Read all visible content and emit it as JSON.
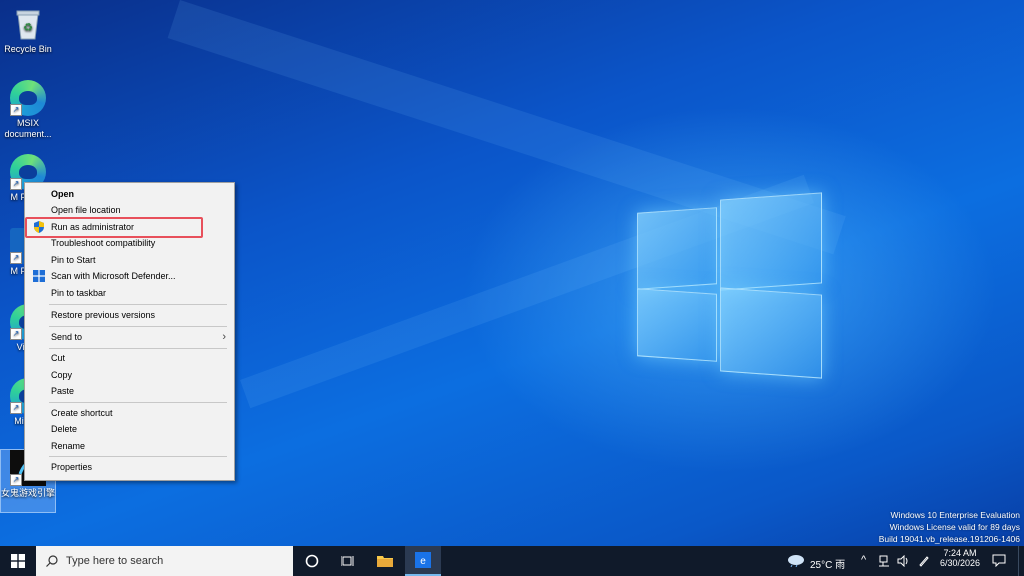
{
  "desktop": {
    "icons": [
      {
        "label": "Recycle Bin"
      },
      {
        "label": "MSIX document..."
      },
      {
        "label": "M Packa"
      },
      {
        "label": "M Packa"
      },
      {
        "label": "Vi Ma"
      },
      {
        "label": "Mic Ed"
      },
      {
        "label": "女鬼游戏引擎"
      }
    ]
  },
  "context_menu": {
    "items": [
      {
        "label": "Open"
      },
      {
        "label": "Open file location"
      },
      {
        "label": "Run as administrator"
      },
      {
        "label": "Troubleshoot compatibility"
      },
      {
        "label": "Pin to Start"
      },
      {
        "label": "Scan with Microsoft Defender..."
      },
      {
        "label": "Pin to taskbar"
      },
      {
        "label": "Restore previous versions"
      },
      {
        "label": "Send to"
      },
      {
        "label": "Cut"
      },
      {
        "label": "Copy"
      },
      {
        "label": "Paste"
      },
      {
        "label": "Create shortcut"
      },
      {
        "label": "Delete"
      },
      {
        "label": "Rename"
      },
      {
        "label": "Properties"
      }
    ],
    "highlight_color": "#e8505b"
  },
  "watermark": {
    "line1": "Windows 10 Enterprise Evaluation",
    "line2": "Windows License valid for 89 days",
    "line3": "Build 19041.vb_release.191206-1406"
  },
  "taskbar": {
    "search_placeholder": "Type here to search",
    "weather": "25°C 雨",
    "time": "7:24 AM",
    "date": "6/30/2026",
    "accent_color": "#76b9ed"
  }
}
